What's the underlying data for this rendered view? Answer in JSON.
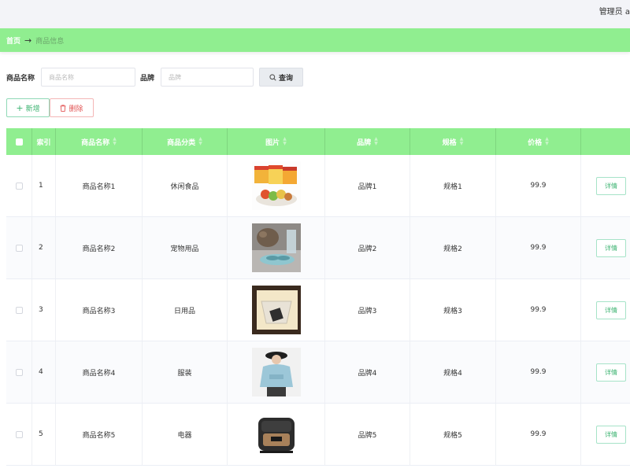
{
  "header": {
    "user_label": "管理员 a"
  },
  "breadcrumb": {
    "home": "首页",
    "separator": "→",
    "current": "商品信息"
  },
  "search": {
    "name_label": "商品名称",
    "name_placeholder": "商品名称",
    "brand_label": "品牌",
    "brand_placeholder": "品牌",
    "query_label": "查询"
  },
  "actions": {
    "add_label": "新增",
    "delete_label": "删除"
  },
  "table": {
    "columns": [
      "索引",
      "商品名称",
      "商品分类",
      "图片",
      "品牌",
      "规格",
      "价格"
    ],
    "detail_label": "详情",
    "rows": [
      {
        "index": "1",
        "name": "商品名称1",
        "category": "休闲食品",
        "image": "snack-food-image",
        "brand": "品牌1",
        "spec": "规格1",
        "price": "99.9"
      },
      {
        "index": "2",
        "name": "商品名称2",
        "category": "宠物用品",
        "image": "pet-feeder-image",
        "brand": "品牌2",
        "spec": "规格2",
        "price": "99.9"
      },
      {
        "index": "3",
        "name": "商品名称3",
        "category": "日用品",
        "image": "soap-dish-image",
        "brand": "品牌3",
        "spec": "规格3",
        "price": "99.9"
      },
      {
        "index": "4",
        "name": "商品名称4",
        "category": "服装",
        "image": "hoodie-model-image",
        "brand": "品牌4",
        "spec": "规格4",
        "price": "99.9"
      },
      {
        "index": "5",
        "name": "商品名称5",
        "category": "电器",
        "image": "rice-cooker-image",
        "brand": "品牌5",
        "spec": "规格5",
        "price": "99.9"
      }
    ]
  },
  "colors": {
    "accent": "#90ee90",
    "add": "#3cb371",
    "delete": "#e25555"
  }
}
